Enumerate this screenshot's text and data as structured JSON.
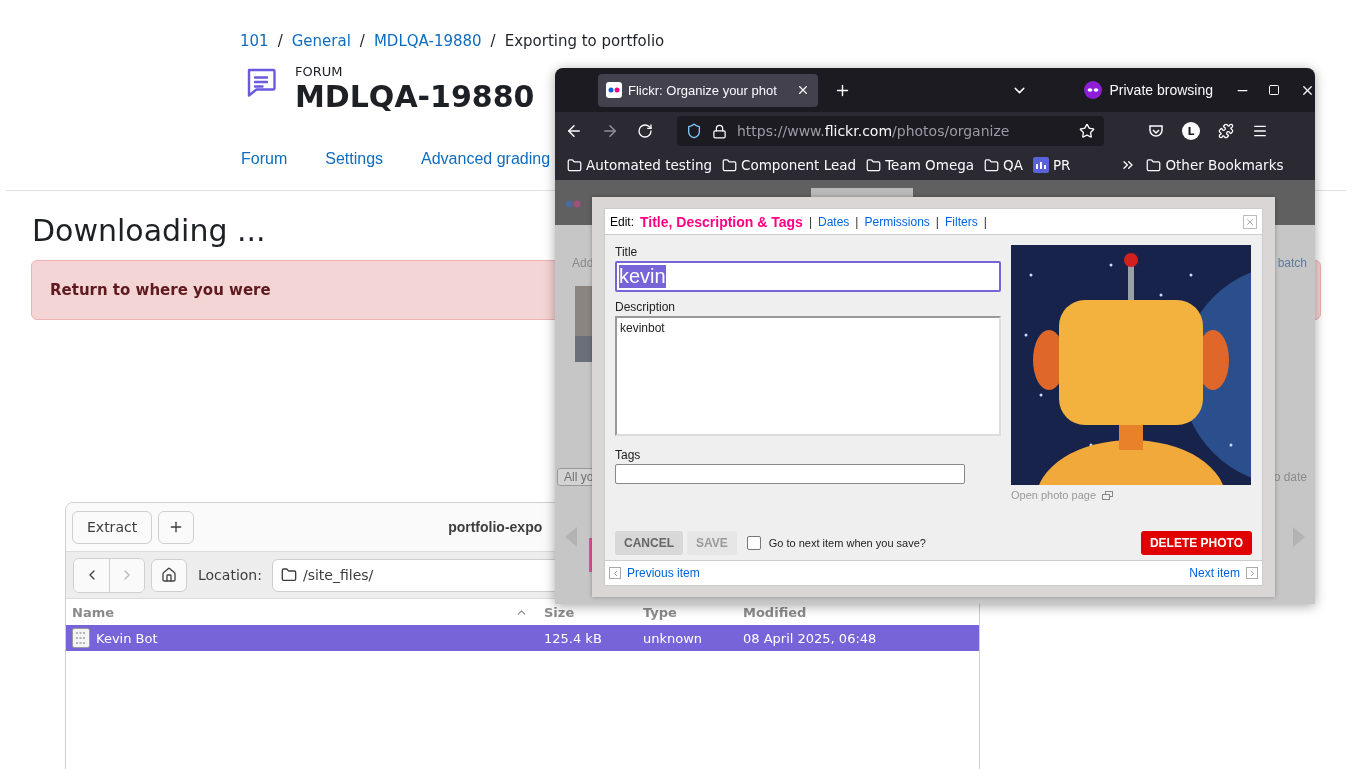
{
  "page": {
    "breadcrumb": [
      {
        "label": "101",
        "link": true
      },
      {
        "label": "General",
        "link": true
      },
      {
        "label": "MDLQA-19880",
        "link": true
      },
      {
        "label": "Exporting to portfolio",
        "link": false
      }
    ],
    "separator": "/",
    "forum": {
      "kicker": "FORUM",
      "title": "MDLQA-19880"
    },
    "nav": [
      "Forum",
      "Settings",
      "Advanced grading"
    ],
    "heading": "Downloading ...",
    "alert": "Return to where you were"
  },
  "file_manager": {
    "extract": "Extract",
    "title": "portfolio-expo",
    "location_label": "Location:",
    "location": "/site_files/",
    "columns": [
      "Name",
      "Size",
      "Type",
      "Modified"
    ],
    "rows": [
      {
        "name": "Kevin Bot",
        "size": "125.4 kB",
        "type": "unknown",
        "modified": "08 April 2025, 06:48",
        "selected": true
      }
    ]
  },
  "browser": {
    "tab": {
      "title": "Flickr: Organize your phot"
    },
    "private_label": "Private browsing",
    "account_initial": "L",
    "url": {
      "prefix": "https://www.",
      "domain": "flickr.com",
      "path": "/photos/organize"
    },
    "bookmarks": [
      {
        "label": "Automated testing",
        "kind": "folder"
      },
      {
        "label": "Component Lead",
        "kind": "folder"
      },
      {
        "label": "Team Omega",
        "kind": "folder"
      },
      {
        "label": "QA",
        "kind": "folder"
      },
      {
        "label": "PR",
        "kind": "site"
      }
    ],
    "other_bookmarks": "Other Bookmarks"
  },
  "flickr_page": {
    "add": "Add",
    "batch": "batch",
    "filter": "All yo",
    "sort": "o date"
  },
  "dialog": {
    "edit_label": "Edit:",
    "separator": "|",
    "tabs": [
      {
        "label": "Title, Description & Tags",
        "selected": true
      },
      {
        "label": "Dates",
        "selected": false
      },
      {
        "label": "Permissions",
        "selected": false
      },
      {
        "label": "Filters",
        "selected": false
      }
    ],
    "title_label": "Title",
    "title_value": "kevin",
    "title_highlighted": true,
    "description_label": "Description",
    "description_value": "kevinbot",
    "tags_label": "Tags",
    "open_photo": "Open photo page",
    "cancel": "CANCEL",
    "save": {
      "label": "SAVE",
      "disabled": true
    },
    "next_on_save": {
      "label": "Go to next item when you save?",
      "checked": false
    },
    "delete": "DELETE PHOTO",
    "previous": "Previous item",
    "next": "Next item"
  }
}
